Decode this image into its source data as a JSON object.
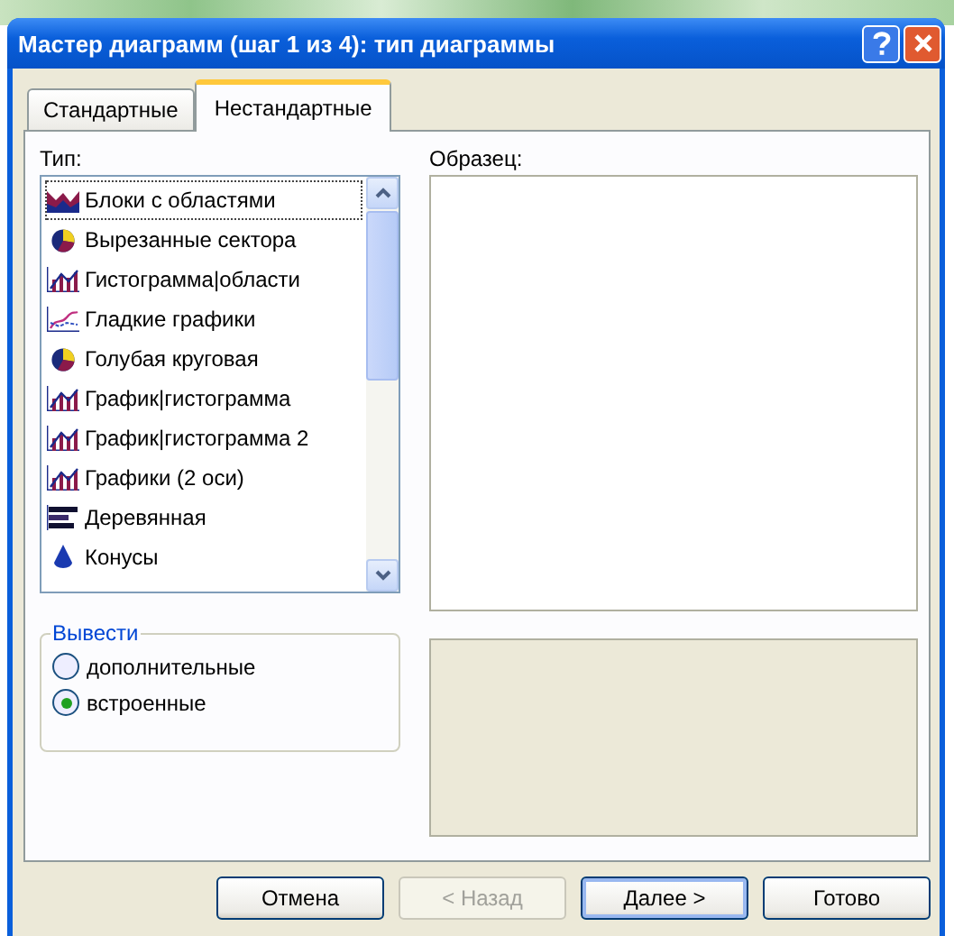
{
  "window": {
    "title": "Мастер диаграмм (шаг 1 из 4): тип диаграммы"
  },
  "tabs": [
    {
      "label": "Стандартные",
      "selected": false
    },
    {
      "label": "Нестандартные",
      "selected": true
    }
  ],
  "type_list": {
    "label": "Тип:",
    "items": [
      {
        "label": "Блоки с областями",
        "kind": "area",
        "focused": true
      },
      {
        "label": "Вырезанные сектора",
        "kind": "pie",
        "focused": false
      },
      {
        "label": "Гистограмма|области",
        "kind": "combo",
        "focused": false
      },
      {
        "label": "Гладкие графики",
        "kind": "line",
        "focused": false
      },
      {
        "label": "Голубая круговая",
        "kind": "pie",
        "focused": false
      },
      {
        "label": "График|гистограмма",
        "kind": "combo",
        "focused": false
      },
      {
        "label": "График|гистограмма 2",
        "kind": "combo",
        "focused": false
      },
      {
        "label": "Графики (2 оси)",
        "kind": "combo",
        "focused": false
      },
      {
        "label": "Деревянная",
        "kind": "hbar",
        "focused": false
      },
      {
        "label": "Конусы",
        "kind": "cone",
        "focused": false
      }
    ]
  },
  "sample": {
    "label": "Образец:"
  },
  "output_group": {
    "label": "Вывести",
    "options": [
      {
        "label": "дополнительные",
        "selected": false
      },
      {
        "label": "встроенные",
        "selected": true
      }
    ]
  },
  "buttons": [
    {
      "label": "Отмена",
      "disabled": false,
      "default": false
    },
    {
      "label": "< Назад",
      "disabled": true,
      "default": false
    },
    {
      "label": "Далее >",
      "disabled": false,
      "default": true
    },
    {
      "label": "Готово",
      "disabled": false,
      "default": false
    }
  ]
}
